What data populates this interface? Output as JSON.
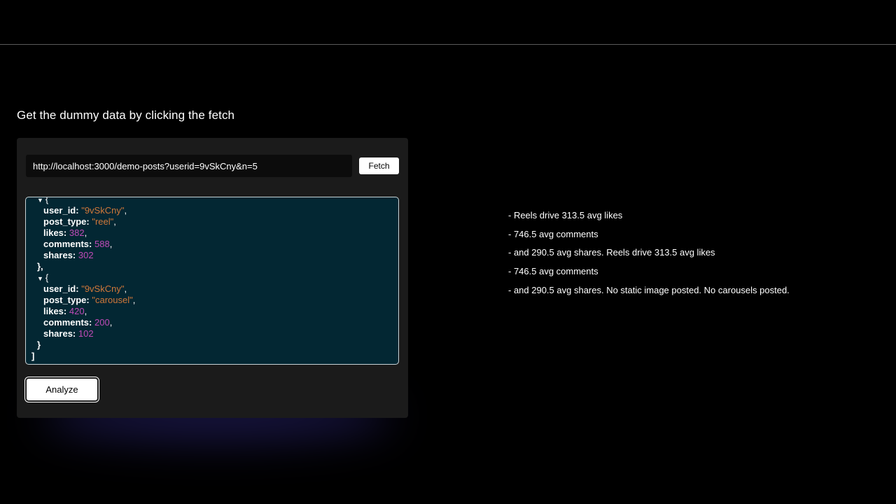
{
  "heading": "Get the dummy data by clicking the fetch",
  "fetch_form": {
    "url_value": "http://localhost:3000/demo-posts?userid=9vSkCny&n=5",
    "fetch_label": "Fetch"
  },
  "json_view": {
    "post_a": {
      "user_id": "\"9vSkCny\"",
      "post_type": "\"reel\"",
      "likes": "382",
      "comments": "588",
      "shares": "302"
    },
    "post_b": {
      "user_id": "\"9vSkCny\"",
      "post_type": "\"carousel\"",
      "likes": "420",
      "comments": "200",
      "shares": "102"
    }
  },
  "analyze_label": "Analyze",
  "results": [
    "- Reels drive 313.5 avg likes",
    "- 746.5 avg comments",
    "- and 290.5 avg shares. Reels drive 313.5 avg likes",
    "- 746.5 avg comments",
    "- and 290.5 avg shares. No static image posted. No carousels posted."
  ],
  "colors": {
    "background": "#000000",
    "card": "#1b1b1b",
    "json_background": "#032733",
    "json_string": "#d1783a",
    "json_number": "#c04bb8"
  }
}
